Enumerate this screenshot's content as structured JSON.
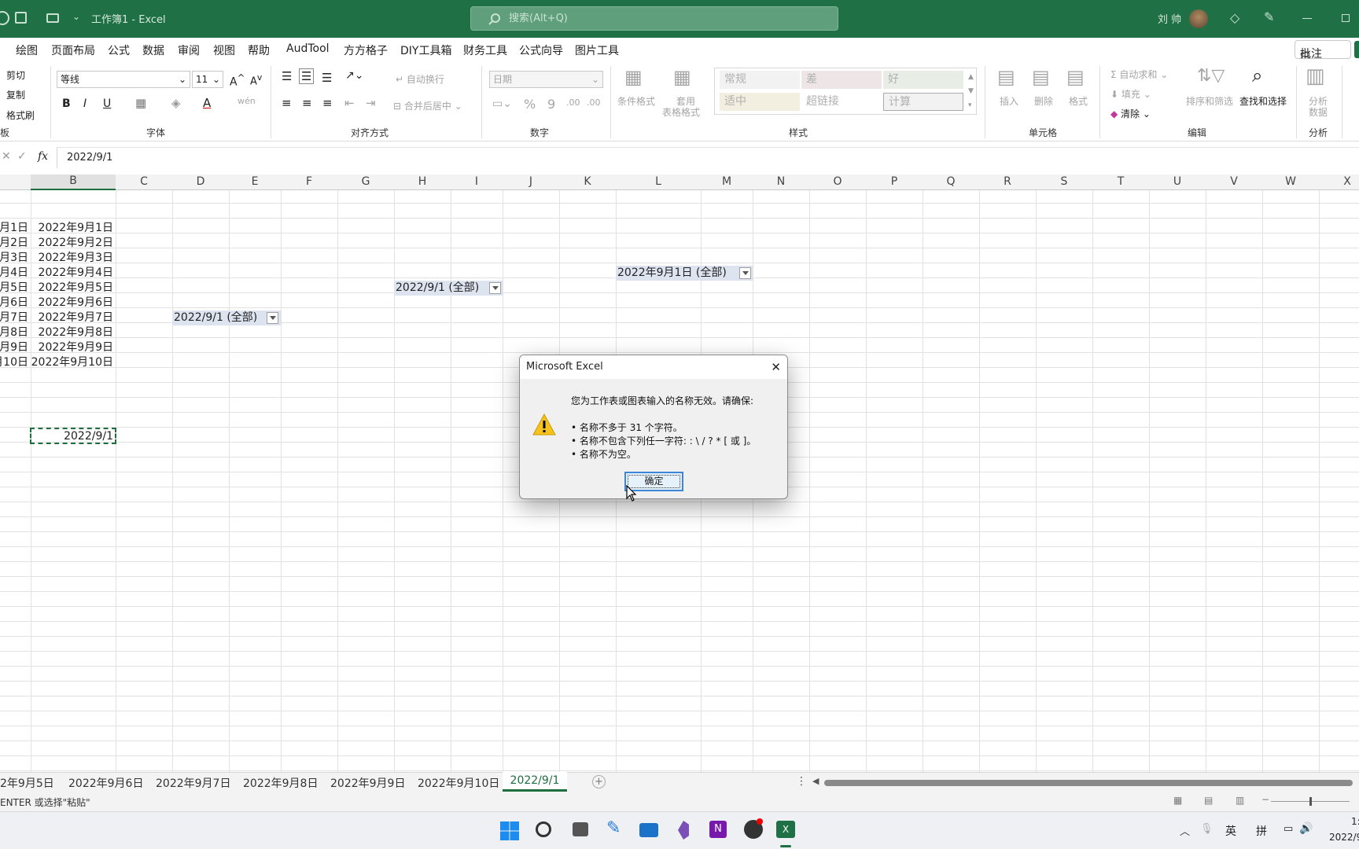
{
  "titlebar": {
    "doc_title": "工作簿1  -  Excel",
    "search_placeholder": "搜索(Alt+Q)",
    "user_name": "刘 帅"
  },
  "menu": {
    "items": [
      "绘图",
      "页面布局",
      "公式",
      "数据",
      "审阅",
      "视图",
      "帮助",
      "AudTool",
      "方方格子",
      "DIY工具箱",
      "财务工具",
      "公式向导",
      "图片工具"
    ],
    "comments_button": "批注"
  },
  "ribbon": {
    "clipboard": {
      "cut": "剪切",
      "copy": "复制",
      "format_painter": "格式刷",
      "label": "板"
    },
    "font": {
      "name": "等线",
      "size": "11",
      "bold": "B",
      "italic": "I",
      "underline": "U",
      "label": "字体"
    },
    "alignment": {
      "wrap": "自动换行",
      "merge": "合并后居中",
      "label": "对齐方式"
    },
    "number": {
      "format": "日期",
      "label": "数字"
    },
    "styles": {
      "conditional": "条件格式",
      "table_line1": "套用",
      "table_line2": "表格格式",
      "cells": [
        "常规",
        "差",
        "好",
        "适中",
        "超链接",
        "计算"
      ],
      "label": "样式"
    },
    "cells_group": {
      "insert": "插入",
      "delete": "删除",
      "format": "格式",
      "label": "单元格"
    },
    "editing": {
      "autosum": "自动求和",
      "fill": "填充",
      "clear": "清除",
      "sort_filter": "排序和筛选",
      "find_select": "查找和选择",
      "label": "编辑"
    },
    "analysis": {
      "line1": "分析",
      "line2": "数据",
      "label": "分析"
    }
  },
  "formula_bar": {
    "fx": "fx",
    "value": "2022/9/1"
  },
  "columns": [
    "B",
    "C",
    "D",
    "E",
    "F",
    "G",
    "H",
    "I",
    "J",
    "K",
    "L",
    "M",
    "N",
    "O",
    "P",
    "Q",
    "R",
    "S",
    "T",
    "U",
    "V",
    "W",
    "X"
  ],
  "sheet": {
    "col_a": [
      "月1日",
      "月2日",
      "月3日",
      "月4日",
      "月5日",
      "月6日",
      "月7日",
      "月8日",
      "月9日",
      "月10日"
    ],
    "col_b": [
      "2022年9月1日",
      "2022年9月2日",
      "2022年9月3日",
      "2022年9月4日",
      "2022年9月5日",
      "2022年9月6日",
      "2022年9月7日",
      "2022年9月8日",
      "2022年9月9日",
      "2022年9月10日"
    ],
    "active_cell": "2022/9/1",
    "pivot_filters": [
      "2022/9/1  (全部)",
      "2022/9/1  (全部)",
      "2022年9月1日  (全部)"
    ]
  },
  "sheet_tabs": [
    "2年9月5日",
    "2022年9月6日",
    "2022年9月7日",
    "2022年9月8日",
    "2022年9月9日",
    "2022年9月10日",
    "2022/9/1"
  ],
  "active_tab": "2022/9/1",
  "status_text": "ENTER 或选择\"粘贴\"",
  "dialog": {
    "title": "Microsoft Excel",
    "message": "您为工作表或图表输入的名称无效。请确保:",
    "rules": [
      "• 名称不多于 31 个字符。",
      "• 名称不包含下列任一字符: : \\ / ? * [ 或 ]。",
      "• 名称不为空。"
    ],
    "ok": "确定"
  },
  "taskbar": {
    "ime_lang": "英",
    "ime_mode": "拼",
    "clock_time": "1:",
    "clock_date": "2022/9/"
  },
  "colors": {
    "excel_green": "#1f7145",
    "pivot_fill": "#dde4f0",
    "selection": "#1e6e3e"
  }
}
